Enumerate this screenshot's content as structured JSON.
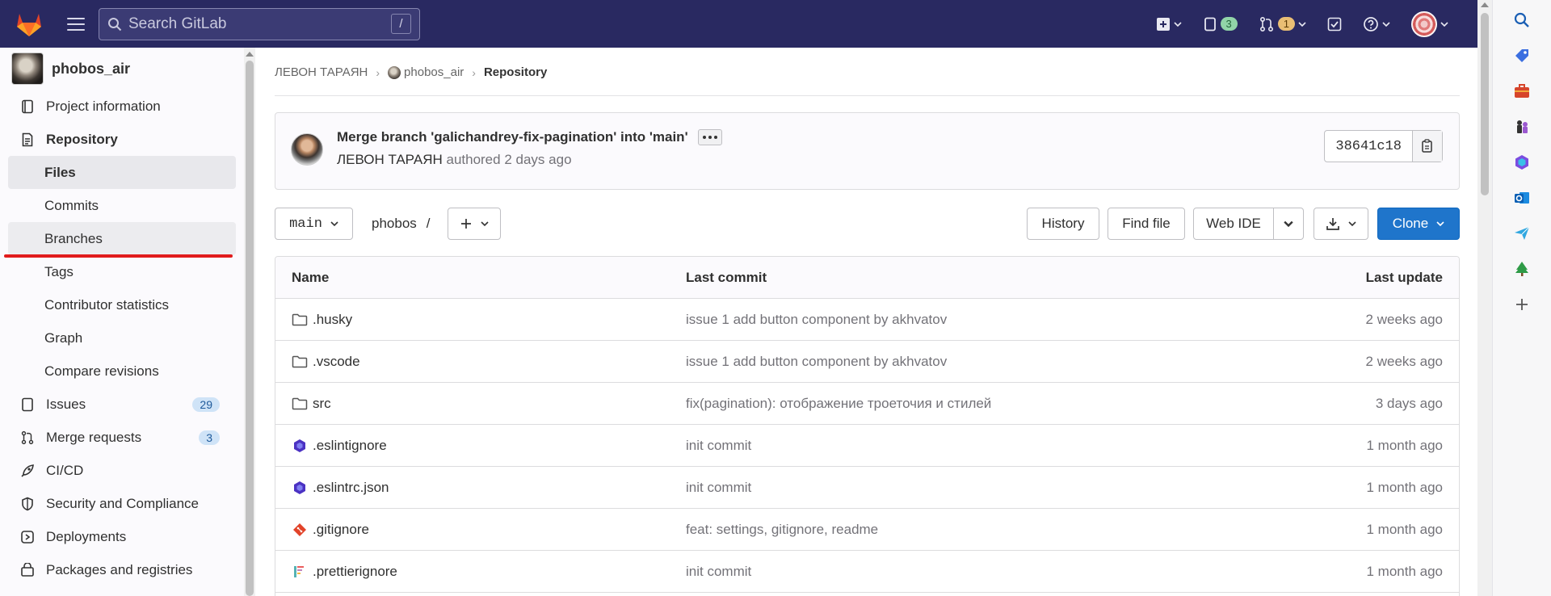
{
  "topbar": {
    "search_placeholder": "Search GitLab",
    "search_shortcut": "/",
    "issues_count": "3",
    "mr_count": "1"
  },
  "sidebar": {
    "project_name": "phobos_air",
    "items": [
      {
        "label": "Project information",
        "icon": "info-icon"
      },
      {
        "label": "Repository",
        "icon": "repository-icon"
      },
      {
        "label": "Issues",
        "icon": "issues-icon",
        "badge": "29"
      },
      {
        "label": "Merge requests",
        "icon": "merge-request-icon",
        "badge": "3"
      },
      {
        "label": "CI/CD",
        "icon": "rocket-icon"
      },
      {
        "label": "Security and Compliance",
        "icon": "shield-icon"
      },
      {
        "label": "Deployments",
        "icon": "deployments-icon"
      },
      {
        "label": "Packages and registries",
        "icon": "package-icon"
      }
    ],
    "repository_sub": [
      "Files",
      "Commits",
      "Branches",
      "Tags",
      "Contributor statistics",
      "Graph",
      "Compare revisions"
    ]
  },
  "breadcrumb": {
    "owner": "ЛЕВОН ТАРАЯН",
    "project": "phobos_air",
    "current": "Repository"
  },
  "commit": {
    "title": "Merge branch 'galichandrey-fix-pagination' into 'main'",
    "author": "ЛЕВОН ТАРАЯН",
    "authored": "authored",
    "time": "2 days ago",
    "sha": "38641c18"
  },
  "toolbar": {
    "branch": "main",
    "path_root": "phobos",
    "path_sep": "/",
    "history": "History",
    "find_file": "Find file",
    "web_ide": "Web IDE",
    "clone": "Clone"
  },
  "table": {
    "headers": {
      "name": "Name",
      "last_commit": "Last commit",
      "last_update": "Last update"
    },
    "rows": [
      {
        "name": ".husky",
        "icon": "folder-icon",
        "commit": "issue 1 add button component by akhvatov",
        "updated": "2 weeks ago"
      },
      {
        "name": ".vscode",
        "icon": "folder-icon",
        "commit": "issue 1 add button component by akhvatov",
        "updated": "2 weeks ago"
      },
      {
        "name": "src",
        "icon": "folder-icon",
        "commit": "fix(pagination): отображение троеточия и стилей",
        "updated": "3 days ago"
      },
      {
        "name": ".eslintignore",
        "icon": "eslint-icon",
        "commit": "init commit",
        "updated": "1 month ago"
      },
      {
        "name": ".eslintrc.json",
        "icon": "eslint-icon",
        "commit": "init commit",
        "updated": "1 month ago"
      },
      {
        "name": ".gitignore",
        "icon": "git-icon",
        "commit": "feat: settings, gitignore, readme",
        "updated": "1 month ago"
      },
      {
        "name": ".prettierignore",
        "icon": "prettier-icon",
        "commit": "init commit",
        "updated": "1 month ago"
      }
    ]
  },
  "colors": {
    "navbar": "#292961",
    "primary": "#1f75cb",
    "highlight_underline": "#e11c1c"
  }
}
